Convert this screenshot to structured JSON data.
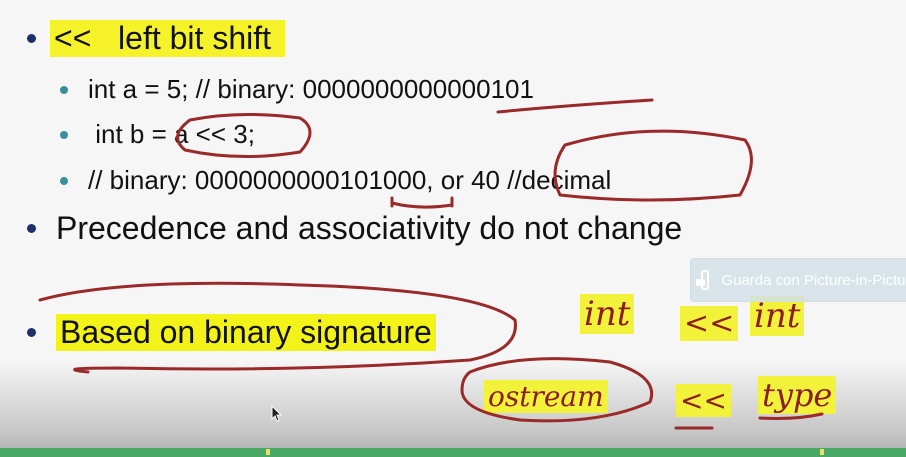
{
  "slide": {
    "items": [
      {
        "level": 1,
        "text": "<<   left bit shift",
        "highlighted": true
      },
      {
        "level": 2,
        "text": "int a = 5; // binary: 0000000000000101"
      },
      {
        "level": 2,
        "text": " int b = a << 3;"
      },
      {
        "level": 2,
        "text": "// binary: 0000000000101000, or 40 //decimal"
      },
      {
        "level": 1,
        "text": "Precedence and associativity do not change"
      },
      {
        "level": 1,
        "text": "Based on binary signature",
        "highlighted": true
      }
    ],
    "annotations": {
      "line1_left": "int",
      "line1_op": "<<",
      "line1_right": "int",
      "line2_left": "ostream",
      "line2_op": "<<",
      "line2_right": "type"
    }
  },
  "overlay": {
    "pip_label": "Guarda con Picture-in-Picture"
  },
  "colors": {
    "highlight": "#f3f31a",
    "ink": "#9a2a2a",
    "bullet_l1": "#1f2f6b",
    "bullet_l2": "#3a8f9a",
    "progress_bar": "#4aa867"
  }
}
